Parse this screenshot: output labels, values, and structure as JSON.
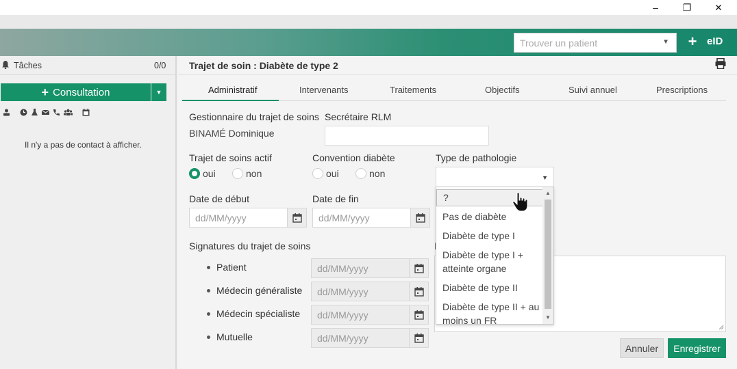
{
  "window": {
    "minimize_glyph": "–",
    "restore_glyph": "❐",
    "close_glyph": "✕"
  },
  "header": {
    "search_placeholder": "Trouver un patient",
    "add_glyph": "+",
    "eid_label": "eID"
  },
  "sidebar": {
    "tasks_label": "Tâches",
    "tasks_count": "0/0",
    "consult_label": "Consultation",
    "consult_plus": "+",
    "empty_message": "Il n'y a pas de contact à afficher.",
    "icons": [
      "patient-icon",
      "clock-icon",
      "flask-icon",
      "mail-icon",
      "phone-icon",
      "group-icon",
      "calendar-icon"
    ]
  },
  "main": {
    "title": "Trajet de soin : Diabète de type 2",
    "tabs": [
      "Administratif",
      "Intervenants",
      "Traitements",
      "Objectifs",
      "Suivi annuel",
      "Prescriptions"
    ],
    "manager_label": "Gestionnaire du trajet de soins",
    "manager_value": "BINAMÉ Dominique",
    "rlm_label": "Secrétaire RLM",
    "active_label": "Trajet de soins actif",
    "convention_label": "Convention diabète",
    "pathology_label": "Type de pathologie",
    "yes": "oui",
    "no": "non",
    "start_label": "Date de début",
    "end_label": "Date de fin",
    "date_placeholder": "dd/MM/yyyy",
    "signatures_label": "Signatures du trajet de soins",
    "signatures": [
      "Patient",
      "Médecin généraliste",
      "Médecin spécialiste",
      "Mutuelle"
    ],
    "peek_letter": "I",
    "cancel_label": "Annuler",
    "save_label": "Enregistrer"
  },
  "dropdown": {
    "options": [
      "?",
      "Pas de diabète",
      "Diabète de type I",
      "Diabète de type I + atteinte organe",
      "Diabète de type II",
      "Diabète de type II + au moins un FR"
    ]
  },
  "colors": {
    "accent": "#159268"
  }
}
